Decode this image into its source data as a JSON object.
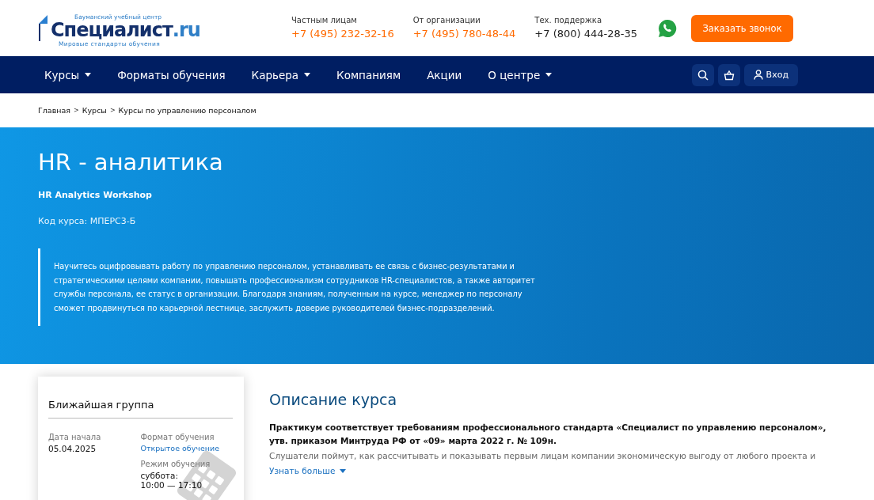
{
  "header": {
    "logo": {
      "tagline_top": "Бауманский учебный центр",
      "brand": "Специалист",
      "suffix": ".ru",
      "tagline_bottom": "Мировые стандарты обучения"
    },
    "contacts": [
      {
        "label": "Частным лицам",
        "phone": "+7 (495) 232-32-16",
        "accent": true
      },
      {
        "label": "От организации",
        "phone": "+7 (495) 780-48-44",
        "accent": true
      },
      {
        "label": "Тех. поддержка",
        "phone": "+7 (800) 444-28-35",
        "accent": false
      }
    ],
    "callback_button": "Заказать звонок"
  },
  "nav": {
    "items": [
      {
        "label": "Курсы",
        "dropdown": true
      },
      {
        "label": "Форматы обучения",
        "dropdown": false
      },
      {
        "label": "Карьера",
        "dropdown": true
      },
      {
        "label": "Компаниям",
        "dropdown": false
      },
      {
        "label": "Акции",
        "dropdown": false
      },
      {
        "label": "О центре",
        "dropdown": true
      }
    ],
    "login": "Вход"
  },
  "breadcrumbs": [
    "Главная",
    "Курсы",
    "Курсы по управлению персоналом"
  ],
  "breadcrumb_separator": ">",
  "hero": {
    "title": "HR - аналитика",
    "subtitle": "HR Analytics Workshop",
    "code": "Код курса: МПЕРС3-Б",
    "description": "Научитесь оцифровывать работу по управлению персоналом, устанавливать ее связь с бизнес-результатами и стратегическими целями компании, повышать профессионализм сотрудников HR-специалистов, а также авторитет службы персонала, ее статус в организации. Благодаря знаниям, полученным на курсе, менеджер по персоналу сможет продвинуться по карьерной лестнице, заслужить доверие руководителей бизнес-подразделений."
  },
  "group_card": {
    "title": "Ближайшая группа",
    "start_label": "Дата начала",
    "start_value": "05.04.2025",
    "format_label": "Формат обучения",
    "format_value": "Открытое обучение",
    "mode_label": "Режим обучения",
    "mode_value": "суббота:",
    "mode_time": "10:00 — 17:10"
  },
  "description": {
    "title": "Описание курса",
    "lead": "Практикум соответствует требованиям профессионального стандарта «Специалист по управлению персоналом», утв. приказом Минтруда РФ от «09» марта 2022 г. № 109н.",
    "text": "Слушатели поймут, как рассчитывать и показывать первым лицам компании экономическую выгоду от любого проекта и",
    "more": "Узнать больше"
  }
}
